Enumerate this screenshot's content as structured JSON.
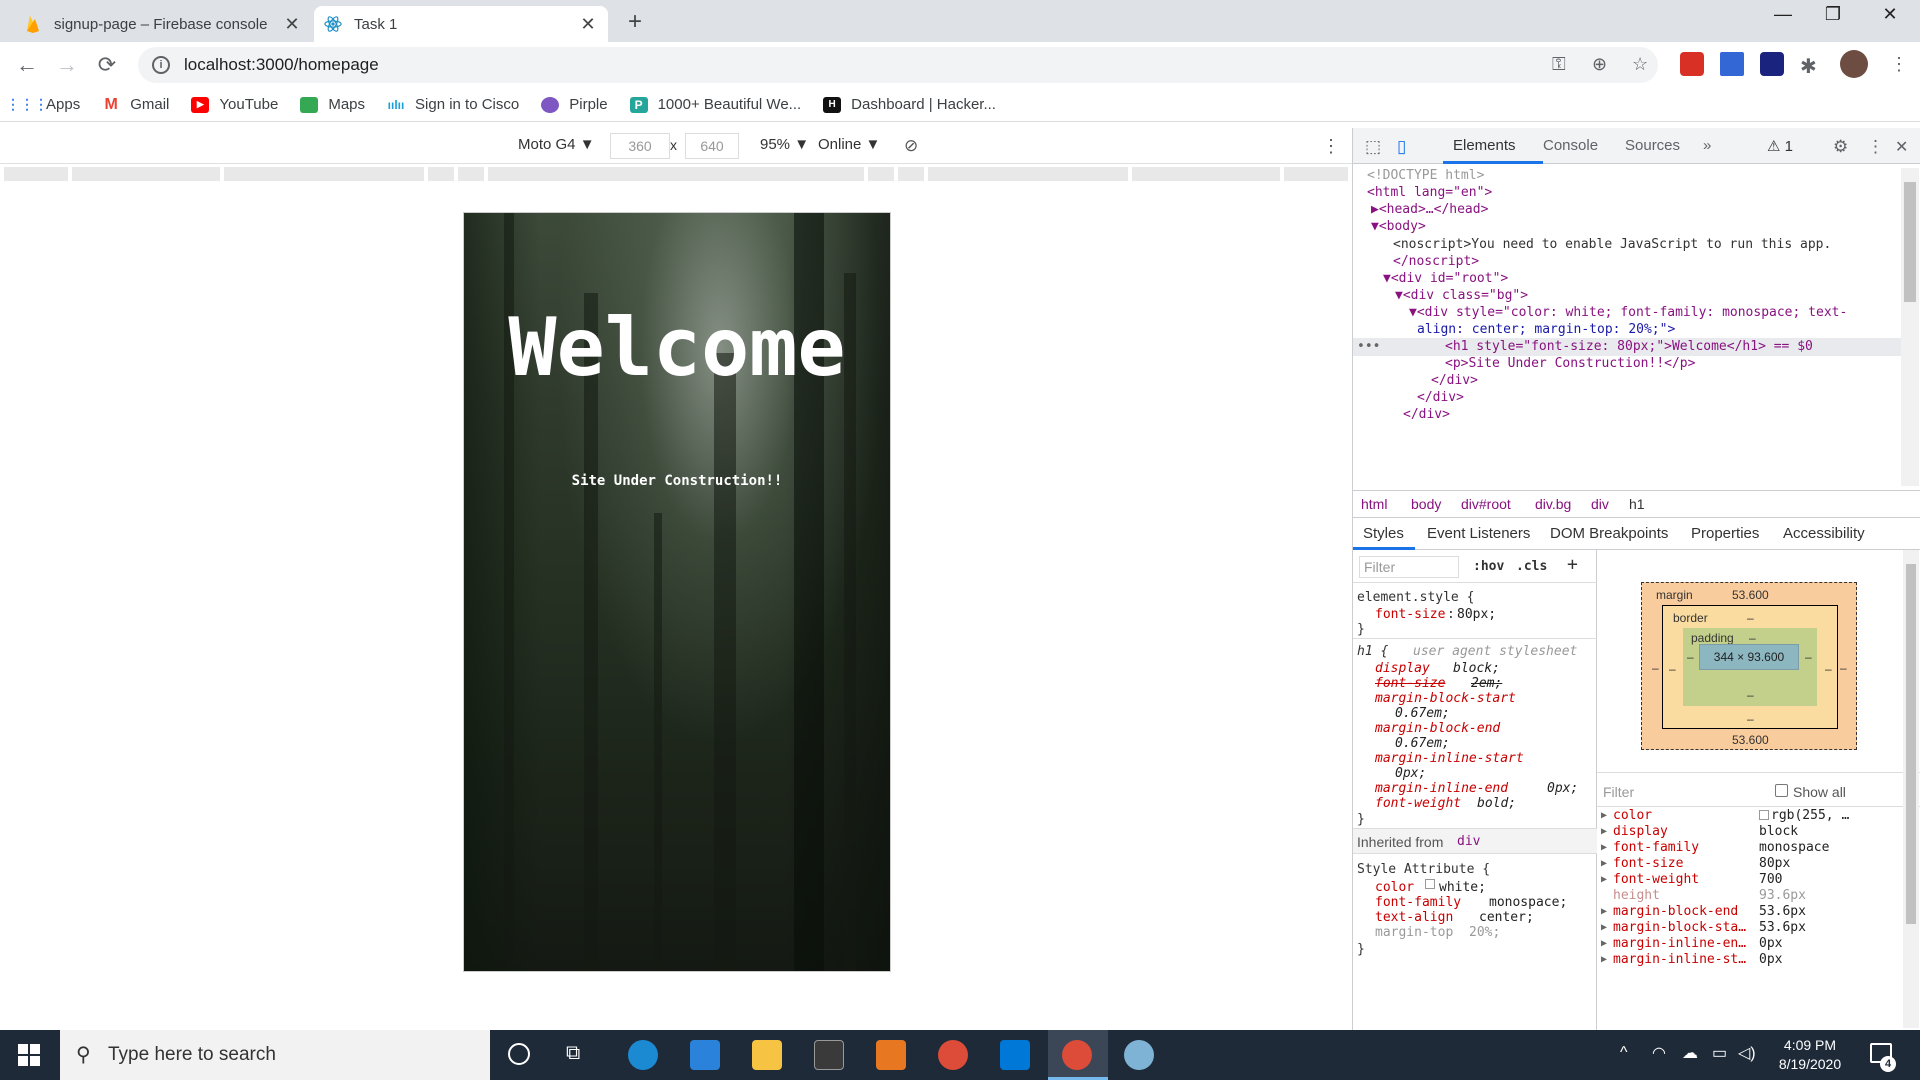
{
  "browser": {
    "tabs": [
      {
        "title": "signup-page – Firebase console",
        "icon": "firebase-icon",
        "active": false
      },
      {
        "title": "Task 1",
        "icon": "react-icon",
        "active": true
      }
    ],
    "url": "localhost:3000/homepage",
    "bookmarks": [
      {
        "label": "Apps",
        "icon": "apps-grid-icon"
      },
      {
        "label": "Gmail",
        "icon": "gmail-icon"
      },
      {
        "label": "YouTube",
        "icon": "youtube-icon"
      },
      {
        "label": "Maps",
        "icon": "maps-icon"
      },
      {
        "label": "Sign in to Cisco",
        "icon": "cisco-icon"
      },
      {
        "label": "Pirple",
        "icon": "pirple-icon"
      },
      {
        "label": "1000+ Beautiful We...",
        "icon": "bookmark-icon"
      },
      {
        "label": "Dashboard | Hacker...",
        "icon": "hackerrank-icon"
      }
    ]
  },
  "device_toolbar": {
    "device": "Moto G4 ▼",
    "width": "360",
    "height": "640",
    "times": "x",
    "zoom": "95% ▼",
    "network": "Online ▼"
  },
  "page": {
    "heading": "Welcome",
    "subtitle": "Site Under Construction!!"
  },
  "devtools": {
    "tabs": [
      "Elements",
      "Console",
      "Sources",
      "»"
    ],
    "warnings": "⚠ 1",
    "dom_lines": [
      "<!DOCTYPE html>",
      "<html lang=\"en\">",
      "▶<head>…</head>",
      "▼<body>",
      "<noscript>You need to enable JavaScript to run this app.",
      "</noscript>",
      "▼<div id=\"root\">",
      "▼<div class=\"bg\">",
      "▼<div style=\"color: white; font-family: monospace; text-",
      "align: center; margin-top: 20%;\">",
      "<h1 style=\"font-size: 80px;\">Welcome</h1> == $0",
      "<p>Site Under Construction!!</p>",
      "</div>",
      "</div>",
      "</div>"
    ],
    "breadcrumbs": [
      "html",
      "body",
      "div#root",
      "div.bg",
      "div",
      "h1"
    ],
    "subtabs": [
      "Styles",
      "Event Listeners",
      "DOM Breakpoints",
      "Properties",
      "Accessibility"
    ],
    "styles": {
      "filter_placeholder": "Filter",
      "hov": ":hov",
      "cls": ".cls",
      "element_style": "element.style {",
      "element_prop": "font-size",
      "element_val": "80px;",
      "ua_selector": "h1 {",
      "ua_source": "user agent stylesheet",
      "ua_rules": [
        {
          "p": "display",
          "v": "block;"
        },
        {
          "p": "font-size",
          "v": "2em;"
        },
        {
          "p": "margin-block-start",
          "v": ""
        },
        {
          "p": "",
          "v": "0.67em;"
        },
        {
          "p": "margin-block-end",
          "v": ""
        },
        {
          "p": "",
          "v": "0.67em;"
        },
        {
          "p": "margin-inline-start",
          "v": ""
        },
        {
          "p": "",
          "v": "0px;"
        },
        {
          "p": "margin-inline-end",
          "v": "0px;"
        },
        {
          "p": "font-weight",
          "v": "bold;"
        }
      ],
      "inherited": "Inherited from",
      "inherited_from": "div",
      "style_attr": "Style Attribute {",
      "attr_rules": [
        {
          "p": "color",
          "v": "white;"
        },
        {
          "p": "font-family",
          "v": "monospace;"
        },
        {
          "p": "text-align",
          "v": "center;"
        },
        {
          "p": "margin-top",
          "v": "20%;"
        }
      ],
      "close_brace": "}"
    },
    "box_model": {
      "margin_label": "margin",
      "margin_top": "53.600",
      "margin_bottom": "53.600",
      "border_label": "border",
      "padding_label": "padding",
      "dash": "–",
      "content": "344 × 93.600"
    },
    "computed": {
      "filter_placeholder": "Filter",
      "show_all": "Show all",
      "rows": [
        {
          "p": "color",
          "v": "rgb(255, …"
        },
        {
          "p": "display",
          "v": "block"
        },
        {
          "p": "font-family",
          "v": "monospace"
        },
        {
          "p": "font-size",
          "v": "80px"
        },
        {
          "p": "font-weight",
          "v": "700"
        },
        {
          "p": "height",
          "v": "93.6px"
        },
        {
          "p": "margin-block-end",
          "v": "53.6px"
        },
        {
          "p": "margin-block-sta…",
          "v": "53.6px"
        },
        {
          "p": "margin-inline-en…",
          "v": "0px"
        },
        {
          "p": "margin-inline-st…",
          "v": "0px"
        }
      ]
    }
  },
  "taskbar": {
    "search_placeholder": "Type here to search",
    "time": "4:09 PM",
    "date": "8/19/2020",
    "notifications": "4"
  }
}
